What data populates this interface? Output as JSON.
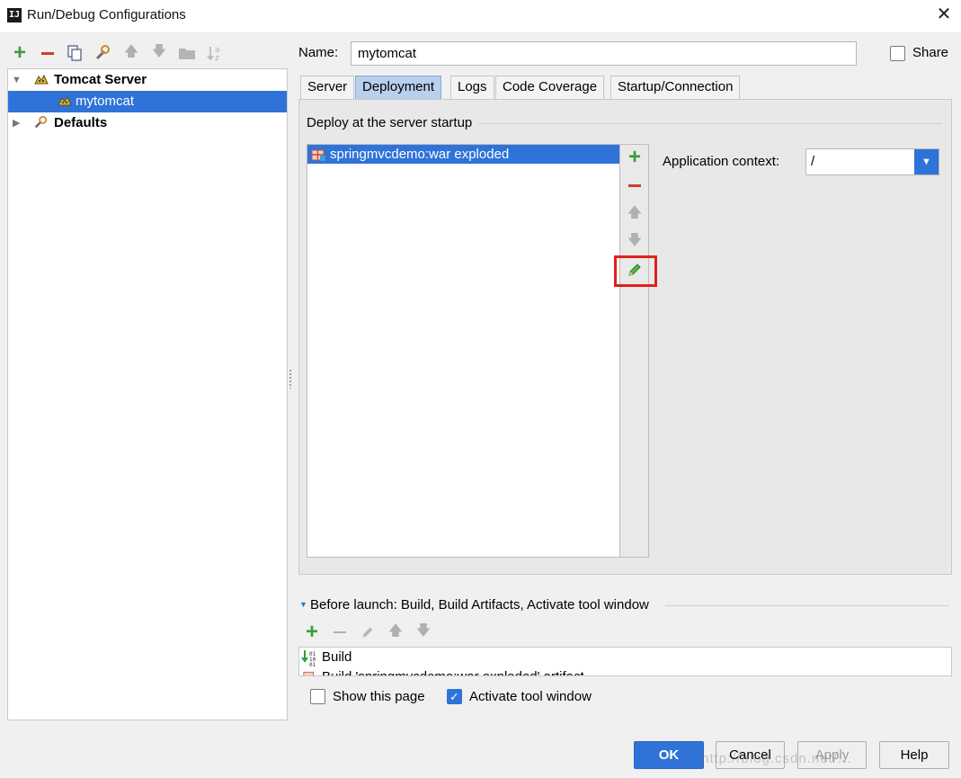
{
  "window": {
    "title": "Run/Debug Configurations",
    "app_icon_text": "IJ"
  },
  "tree": {
    "items": [
      {
        "label": "Tomcat Server",
        "icon": "tomcat-icon",
        "expanded": true
      },
      {
        "label": "mytomcat",
        "icon": "tomcat-icon",
        "selected": true
      },
      {
        "label": "Defaults",
        "icon": "wrench-icon",
        "expanded": false
      }
    ]
  },
  "name_field": {
    "label": "Name:",
    "value": "mytomcat"
  },
  "share": {
    "label": "Share",
    "checked": false
  },
  "tabs": [
    {
      "label": "Server"
    },
    {
      "label": "Deployment",
      "active": true
    },
    {
      "label": "Logs"
    },
    {
      "label": "Code Coverage"
    },
    {
      "label": "Startup/Connection"
    }
  ],
  "deployment": {
    "title": "Deploy at the server startup",
    "items": [
      {
        "label": "springmvcdemo:war exploded",
        "selected": true
      }
    ],
    "app_context_label": "Application context:",
    "app_context_value": "/"
  },
  "before_launch": {
    "title": "Before launch: Build, Build Artifacts, Activate tool window",
    "items": [
      {
        "label": "Build"
      },
      {
        "label": "Build 'springmvcdemo:war exploded' artifact"
      }
    ]
  },
  "options": {
    "show_page": {
      "label": "Show this page",
      "checked": false
    },
    "activate_tool_window": {
      "label": "Activate tool window",
      "checked": true
    }
  },
  "buttons": {
    "ok": "OK",
    "cancel": "Cancel",
    "apply": "Apply",
    "help": "Help"
  },
  "watermark": "http://blog.csdn.net/...",
  "colors": {
    "accent": "#2f73d9",
    "highlight_box": "#e0211d",
    "add_green": "#3a9d3a",
    "remove_red": "#d33a2b"
  }
}
